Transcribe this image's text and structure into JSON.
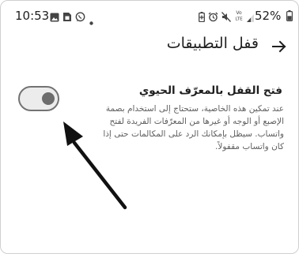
{
  "status_bar": {
    "time": "10:53",
    "battery_percent": "52%",
    "icons_left": [
      "gallery-icon",
      "sim-card-icon",
      "whatsapp-icon",
      "notification-dot-icon"
    ],
    "icons_right": [
      "battery-saver-icon",
      "alarm-icon",
      "mute-icon",
      "volte-icon",
      "signal-icon",
      "battery-icon"
    ]
  },
  "header": {
    "title": "قفل التطبيقات",
    "back_icon": "back-arrow-icon"
  },
  "biometric_setting": {
    "title": "فتح القفل بالمعرّف الحيوي",
    "description": "عند تمكين هذه الخاصية، ستحتاج إلى استخدام بصمة الإصبع أو الوجه أو غيرها من المعرّفات الفريدة لفتح واتساب. سيظل بإمكانك الرد على المكالمات حتى إذا كان واتساب مقفولاً.",
    "toggle_on": false
  },
  "annotation": {
    "arrow_color": "#111111"
  }
}
